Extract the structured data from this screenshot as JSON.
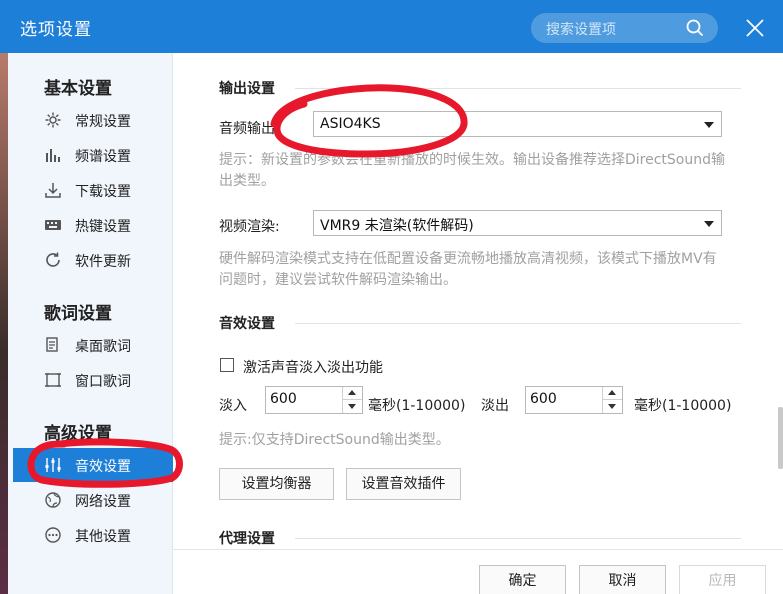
{
  "window": {
    "title": "选项设置",
    "search_placeholder": "搜索设置项"
  },
  "sidebar": {
    "groups": [
      {
        "title": "基本设置",
        "items": [
          {
            "label": "常规设置",
            "icon": "gear-icon"
          },
          {
            "label": "频谱设置",
            "icon": "spectrum-icon"
          },
          {
            "label": "下载设置",
            "icon": "download-icon"
          },
          {
            "label": "热键设置",
            "icon": "keyboard-icon"
          },
          {
            "label": "软件更新",
            "icon": "refresh-icon"
          }
        ]
      },
      {
        "title": "歌词设置",
        "items": [
          {
            "label": "桌面歌词",
            "icon": "desktop-lyrics-icon"
          },
          {
            "label": "窗口歌词",
            "icon": "window-lyrics-icon"
          }
        ]
      },
      {
        "title": "高级设置",
        "items": [
          {
            "label": "音效设置",
            "icon": "equalizer-icon",
            "active": true
          },
          {
            "label": "网络设置",
            "icon": "network-icon"
          },
          {
            "label": "其他设置",
            "icon": "more-icon"
          }
        ]
      }
    ]
  },
  "output": {
    "section_title": "输出设置",
    "audio_label": "音频输出:",
    "audio_value": "ASIO4KS",
    "audio_hint": "提示：新设置的参数会在重新播放的时候生效。输出设备推荐选择DirectSound输出类型。",
    "video_label": "视频渲染:",
    "video_value": "VMR9 未渲染(软件解码)",
    "video_hint": "硬件解码渲染模式支持在低配置设备更流畅地播放高清视频，该模式下播放MV有问题时，建议尝试软件解码渲染输出。"
  },
  "effects": {
    "section_title": "音效设置",
    "fade_checkbox_label": "激活声音淡入淡出功能",
    "fade_in_label": "淡入",
    "fade_in_value": "600",
    "fade_in_unit": "毫秒(1-10000)",
    "fade_out_label": "淡出",
    "fade_out_value": "600",
    "fade_out_unit": "毫秒(1-10000)",
    "hint": "提示:仅支持DirectSound输出类型。",
    "equalizer_button": "设置均衡器",
    "plugin_button": "设置音效插件"
  },
  "proxy": {
    "section_title": "代理设置"
  },
  "footer": {
    "ok": "确定",
    "cancel": "取消",
    "apply": "应用"
  },
  "colors": {
    "accent": "#1e7fd8",
    "annotation": "#e8182c",
    "hint_text": "#a0a0a0"
  }
}
